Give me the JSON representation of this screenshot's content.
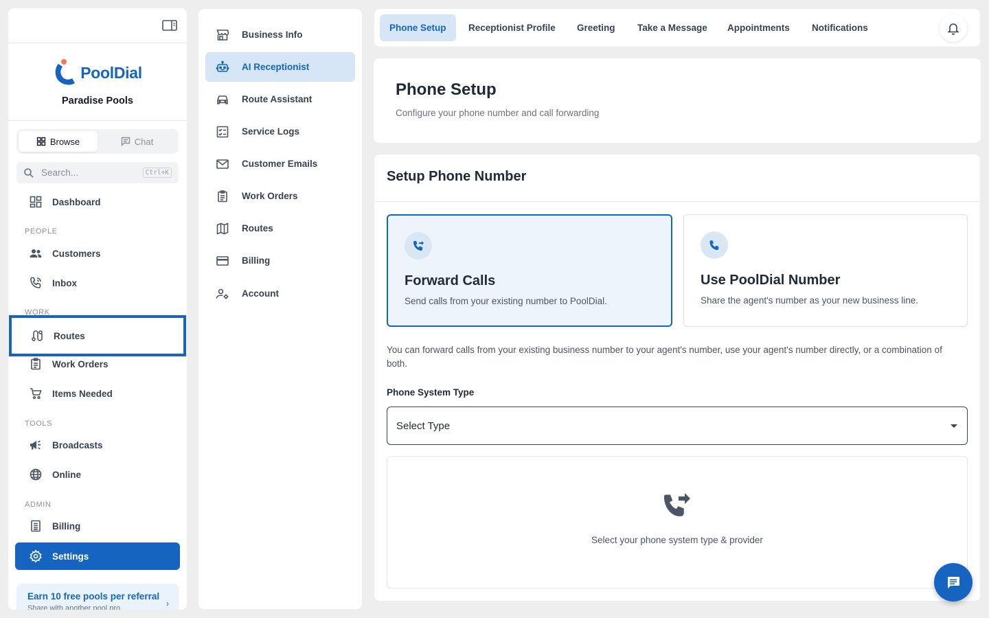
{
  "brand": {
    "logo_text": "PoolDial",
    "company": "Paradise Pools"
  },
  "mode_toggle": {
    "browse": "Browse",
    "chat": "Chat",
    "active": "Browse"
  },
  "search": {
    "placeholder": "Search...",
    "shortcut": "Ctrl+K"
  },
  "sidebar": {
    "dashboard": "Dashboard",
    "sections": {
      "people": "PEOPLE",
      "work": "WORK",
      "tools": "TOOLS",
      "admin": "ADMIN"
    },
    "items": {
      "customers": "Customers",
      "inbox": "Inbox",
      "routes": "Routes",
      "work_orders": "Work Orders",
      "items_needed": "Items Needed",
      "broadcasts": "Broadcasts",
      "online": "Online",
      "billing": "Billing",
      "settings": "Settings"
    },
    "active_item": "Settings",
    "focused_item": "Routes"
  },
  "referral": {
    "title": "Earn 10 free pools per referral",
    "subtitle": "Share with another pool pro"
  },
  "settings_menu": {
    "items": [
      "Business Info",
      "AI Receptionist",
      "Route Assistant",
      "Service Logs",
      "Customer Emails",
      "Work Orders",
      "Routes",
      "Billing",
      "Account"
    ],
    "active": "AI Receptionist"
  },
  "tabs": {
    "items": [
      "Phone Setup",
      "Receptionist Profile",
      "Greeting",
      "Take a Message",
      "Appointments",
      "Notifications"
    ],
    "active": "Phone Setup"
  },
  "header": {
    "title": "Phone Setup",
    "subtitle": "Configure your phone number and call forwarding"
  },
  "setup": {
    "title": "Setup Phone Number",
    "options": [
      {
        "title": "Forward Calls",
        "description": "Send calls from your existing number to PoolDial.",
        "selected": true
      },
      {
        "title": "Use PoolDial Number",
        "description": "Share the agent's number as your new business line.",
        "selected": false
      }
    ],
    "info": "You can forward calls from your existing business number to your agent's number, use your agent's number directly, or a combination of both.",
    "phone_system_label": "Phone System Type",
    "phone_system_value": "Select Type",
    "empty_text": "Select your phone system type & provider"
  },
  "colors": {
    "primary": "#1565c0",
    "active_bg": "#d6e6f6",
    "page_bg": "#eeeeee",
    "logo_accent": "#ef7c57"
  }
}
